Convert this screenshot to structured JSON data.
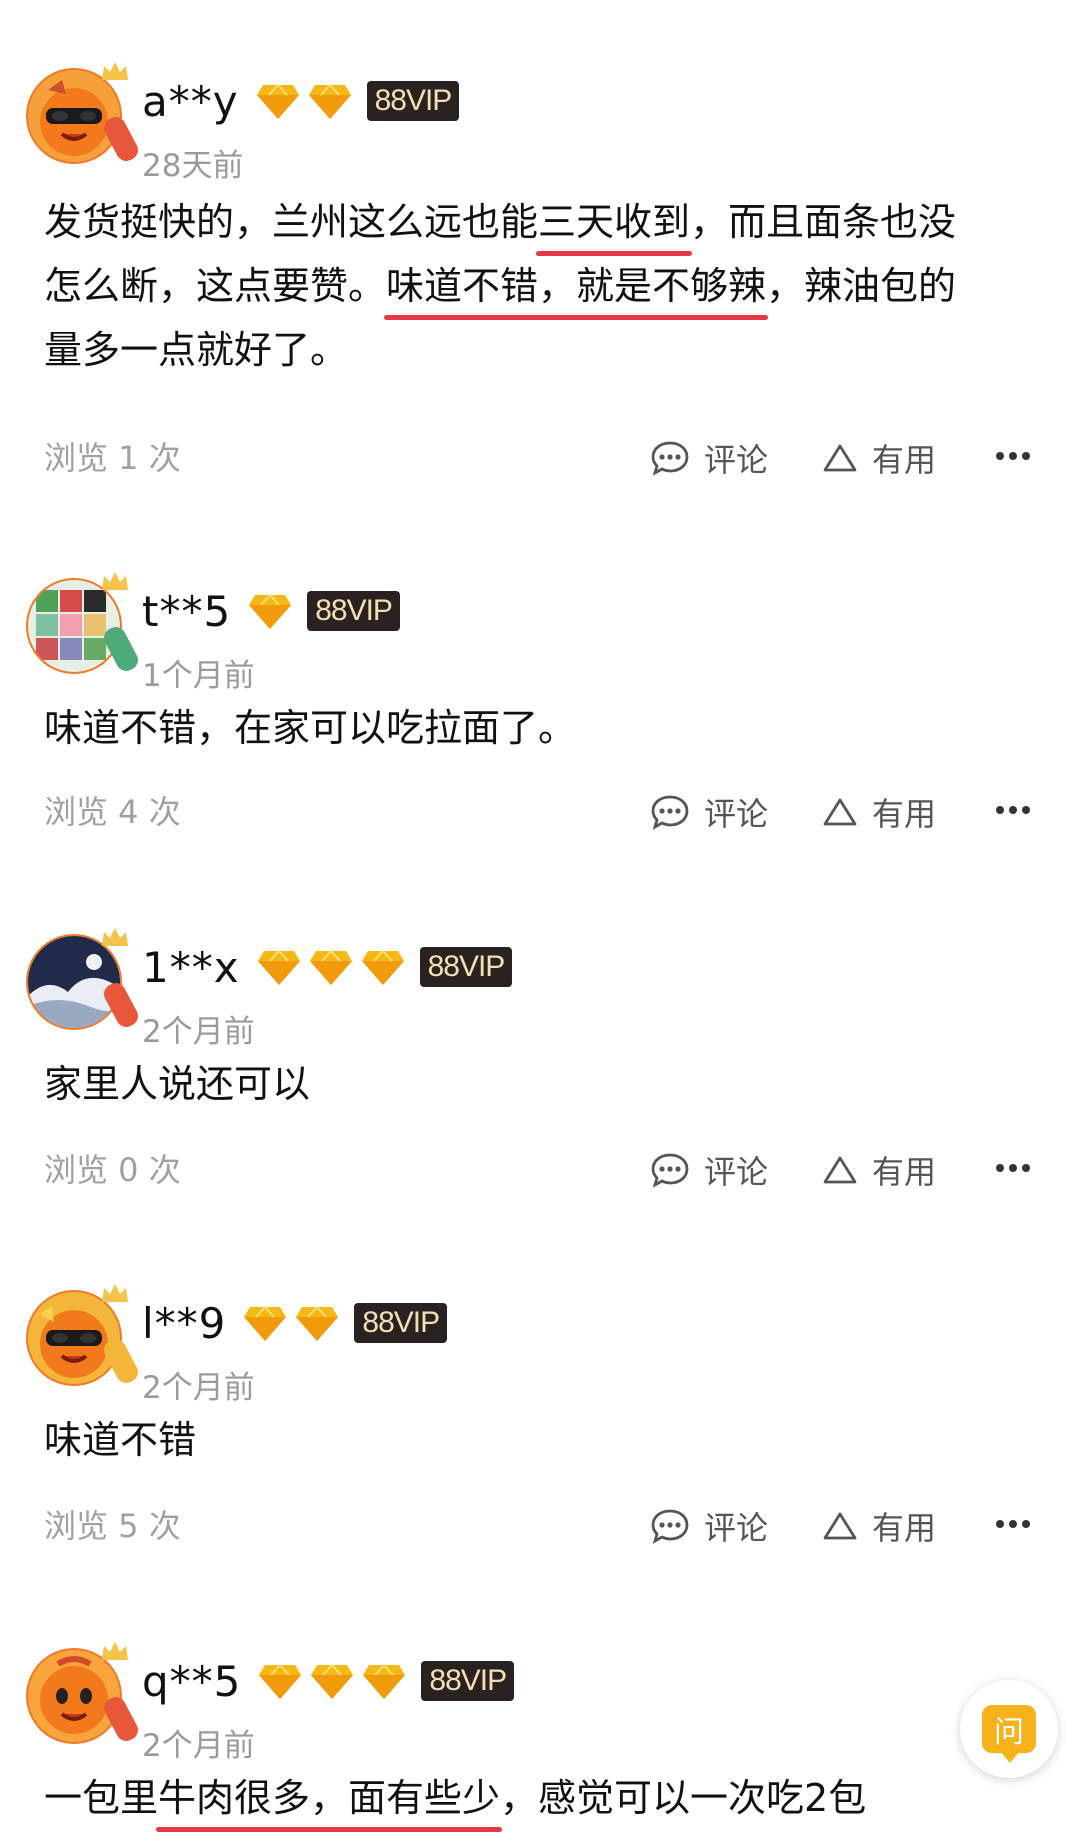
{
  "reviews": [
    {
      "user": "a**y",
      "diamonds": 2,
      "vip": "88VIP",
      "time": "28天前",
      "text_parts": [
        {
          "t": "发货挺快的，兰州这么远也能",
          "u": false
        },
        {
          "t": "三天收到",
          "u": true
        },
        {
          "t": "，而且面条也没",
          "u": false
        },
        {
          "t": "怎么断，这点要赞。",
          "u": false
        },
        {
          "t": "味道不错，就是不够辣",
          "u": true
        },
        {
          "t": "，辣油包的",
          "u": false
        },
        {
          "t": "量多一点就好了。",
          "u": false
        }
      ],
      "views": "浏览 1 次",
      "avatar_color": "#f5a03a"
    },
    {
      "user": "t**5",
      "diamonds": 1,
      "vip": "88VIP",
      "time": "1个月前",
      "text_parts": [
        {
          "t": "味道不错，在家可以吃拉面了。",
          "u": false
        }
      ],
      "views": "浏览 4 次",
      "avatar_color": "#4fa05a"
    },
    {
      "user": "1**x",
      "diamonds": 3,
      "vip": "88VIP",
      "time": "2个月前",
      "text_parts": [
        {
          "t": "家里人说还可以",
          "u": false
        }
      ],
      "views": "浏览 0 次",
      "avatar_color": "#2d3a55"
    },
    {
      "user": "l**9",
      "diamonds": 2,
      "vip": "88VIP",
      "time": "2个月前",
      "text_parts": [
        {
          "t": "味道不错",
          "u": false
        }
      ],
      "views": "浏览 5 次",
      "avatar_color": "#f3b63a"
    },
    {
      "user": "q**5",
      "diamonds": 3,
      "vip": "88VIP",
      "time": "2个月前",
      "text_parts": [
        {
          "t": "一包里",
          "u": false
        },
        {
          "t": "牛肉很多，面有些少",
          "u": true
        },
        {
          "t": "，感觉可以一次吃2包",
          "u": false
        }
      ],
      "views": "",
      "avatar_color": "#f07a2a"
    }
  ],
  "actions": {
    "comment_label": "评论",
    "useful_label": "有用",
    "comment_icon": "speech-bubble-icon",
    "useful_icon": "triangle-icon",
    "more_icon": "more-dots-icon"
  },
  "ask_button": {
    "label": "问",
    "color": "#f6b21b"
  },
  "colors": {
    "underline": "#e43a46",
    "vip_bg": "#2a2220",
    "vip_text": "#f3dfb4",
    "diamond": "#f5b814"
  }
}
